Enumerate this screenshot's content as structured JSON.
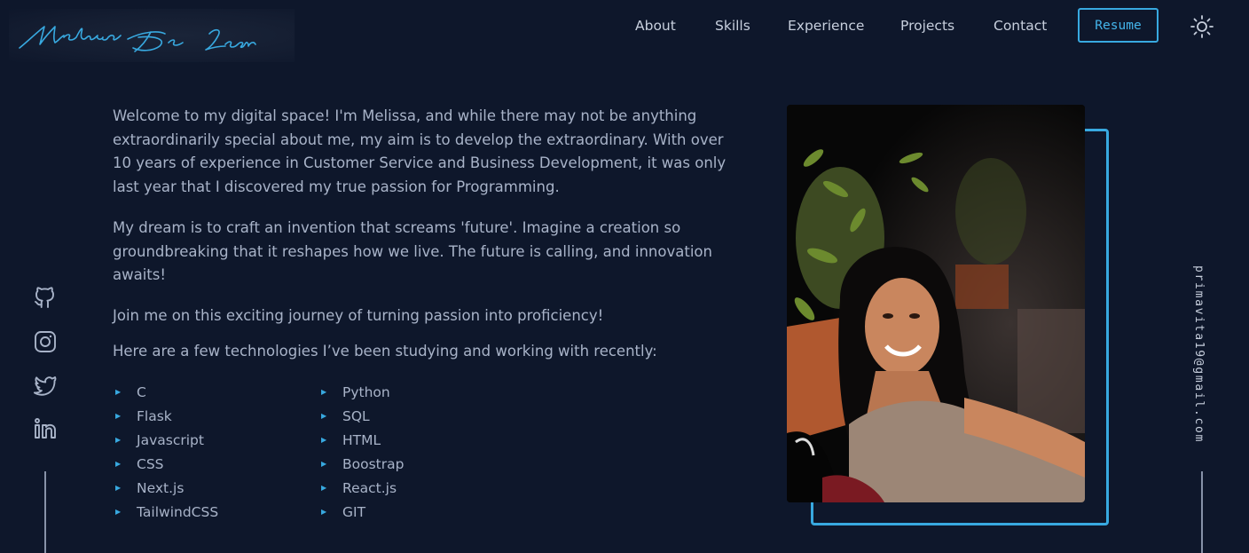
{
  "header": {
    "logo_text": "Melissa De Leon",
    "nav": [
      "About",
      "Skills",
      "Experience",
      "Projects",
      "Contact"
    ],
    "resume_label": "Resume",
    "theme_icon": "sun-icon"
  },
  "about": {
    "paragraphs": [
      "Welcome to my digital space! I'm Melissa, and while there may not be anything extraordinarily special about me, my aim is to develop the extraordinary. With over 10 years of experience in Customer Service and Business Development, it was only last year that I discovered my true passion for Programming.",
      "My dream is to craft an invention that screams 'future'. Imagine a creation so groundbreaking that it reshapes how we live. The future is calling, and innovation awaits!",
      "Join me on this exciting journey of turning passion into proficiency!"
    ],
    "tech_heading": "Here are a few technologies I’ve been studying and working with recently:",
    "tech_col1": [
      "C",
      "Flask",
      "Javascript",
      "CSS",
      "Next.js",
      "TailwindCSS"
    ],
    "tech_col2": [
      "Python",
      "SQL",
      "HTML",
      "Boostrap",
      "React.js",
      "GIT"
    ]
  },
  "social": [
    "github-icon",
    "instagram-icon",
    "twitter-icon",
    "linkedin-icon"
  ],
  "email": "primavita19@gmail.com",
  "colors": {
    "background": "#0e172b",
    "accent": "#38a9e0",
    "text": "#a8b3c8"
  }
}
